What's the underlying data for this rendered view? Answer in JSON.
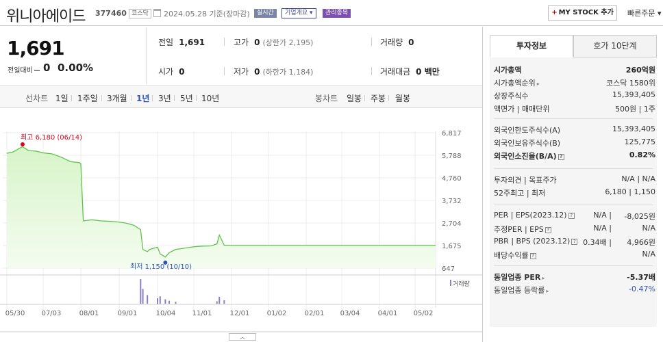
{
  "header": {
    "name": "위니아에이드",
    "code": "377460",
    "market": "코스닥",
    "date": "2024.05.28 기준(장마감)",
    "badge_realtime": "실시간",
    "badge_corp": "기업개요 ▾",
    "badge_admin": "관리종목",
    "mystock": "MY STOCK 추가",
    "quick_order": "빠른주문 ▾",
    "colors": {
      "admin": "#7c4fb0",
      "realtime": "#7b86a6"
    }
  },
  "quote": {
    "price": "1,691",
    "change_label": "전일대비",
    "change": "0",
    "change_pct": "0.00%",
    "stats": [
      {
        "k": "전일",
        "v": "1,691",
        "sub": ""
      },
      {
        "k": "고가",
        "v": "0",
        "sub": "(상한가 2,195)"
      },
      {
        "k": "거래량",
        "v": "0",
        "sub": ""
      },
      {
        "k": "시가",
        "v": "0",
        "sub": ""
      },
      {
        "k": "저가",
        "v": "0",
        "sub": "(하한가 1,184)"
      },
      {
        "k": "거래대금",
        "v": "0 백만",
        "sub": ""
      }
    ]
  },
  "period": {
    "line_label": "선차트",
    "options": [
      "1일",
      "1주일",
      "3개월",
      "1년",
      "3년",
      "5년",
      "10년"
    ],
    "selected": "1년",
    "candle_label": "봉차트",
    "candle_options": [
      "일봉",
      "주봉",
      "월봉"
    ]
  },
  "chart_data": {
    "type": "area",
    "y_ticks": [
      "6,817",
      "5,788",
      "4,760",
      "3,732",
      "2,704",
      "1,675",
      "647"
    ],
    "ylim": [
      647,
      6817
    ],
    "x_ticks": [
      "05/30",
      "07/03",
      "08/01",
      "09/01",
      "10/04",
      "11/01",
      "12/01",
      "01/02",
      "02/01",
      "03/04",
      "04/01",
      "05/02"
    ],
    "high_label": "최고 6,180 (06/14)",
    "low_label": "최저 1,150 (10/10)",
    "volume_label": "거래량",
    "x": [
      "05/30",
      "06/05",
      "06/14",
      "06/20",
      "06/27",
      "07/03",
      "07/10",
      "07/17",
      "07/24",
      "07/31",
      "08/01",
      "08/03",
      "08/10",
      "08/17",
      "08/24",
      "08/31",
      "09/07",
      "09/14",
      "09/20",
      "09/22",
      "09/26",
      "09/28",
      "10/04",
      "10/06",
      "10/10",
      "10/13",
      "10/18",
      "10/24",
      "11/01",
      "11/08",
      "11/15",
      "11/20",
      "11/22",
      "11/26",
      "12/01",
      "01/02",
      "02/01",
      "03/04",
      "04/01",
      "05/02",
      "05/28"
    ],
    "series": [
      {
        "values": [
          5880,
          5940,
          6180,
          6000,
          5980,
          5900,
          5850,
          5700,
          5500,
          5450,
          5400,
          2800,
          2850,
          2800,
          2780,
          2750,
          2700,
          2600,
          2400,
          1500,
          1400,
          1500,
          1600,
          1300,
          1150,
          1350,
          1500,
          1550,
          1620,
          1650,
          1660,
          1750,
          2150,
          1690,
          1691,
          1691,
          1691,
          1691,
          1691,
          1691,
          1691
        ]
      }
    ],
    "volume": [
      {
        "x": "09/20",
        "v": 100
      },
      {
        "x": "09/22",
        "v": 60
      },
      {
        "x": "09/26",
        "v": 35
      },
      {
        "x": "10/04",
        "v": 22
      },
      {
        "x": "10/06",
        "v": 30
      },
      {
        "x": "10/10",
        "v": 18
      },
      {
        "x": "10/13",
        "v": 12
      },
      {
        "x": "10/18",
        "v": 8
      },
      {
        "x": "11/20",
        "v": 10
      },
      {
        "x": "11/22",
        "v": 28
      },
      {
        "x": "11/26",
        "v": 14
      }
    ],
    "colors": {
      "line": "#5cc448",
      "fill_top": "#d7f4c9",
      "fill_bottom": "#f4fcf0",
      "high": "#e0001b",
      "low": "#2f54b8",
      "volume": "#8a7fc0"
    }
  },
  "panel": {
    "tab_invest": "투자정보",
    "tab_ask": "호가 10단계",
    "rows": [
      {
        "k": "시가총액",
        "v": "260억원",
        "bold": true
      },
      {
        "k": "시가총액순위",
        "v": "코스닥 1580위"
      },
      {
        "k": "상장주식수",
        "v": "15,393,405"
      },
      {
        "k": "액면가 | 매매단위",
        "v": "500원 | 1주"
      },
      {
        "k": "외국인한도주식수(A)",
        "v": "15,393,405"
      },
      {
        "k": "외국인보유주식수(B)",
        "v": "125,775"
      },
      {
        "k": "외국인소진율(B/A)",
        "v": "0.82%",
        "bold": true
      },
      {
        "k": "투자의견 | 목표주가",
        "v": "N/A | N/A"
      },
      {
        "k": "52주최고 | 최저",
        "v": "6,180 | 1,150"
      },
      {
        "k": "PER | EPS(2023.12)",
        "v1": "N/A",
        "v": "-8,025원"
      },
      {
        "k": "추정PER | EPS",
        "v1": "N/A",
        "v": "N/A"
      },
      {
        "k": "PBR | BPS (2023.12)",
        "v1": "0.34배",
        "v": "4,966원"
      },
      {
        "k": "배당수익률",
        "v": "N/A"
      },
      {
        "k": "동일업종 PER",
        "v": "-5.37배",
        "bold": true
      },
      {
        "k": "동일업종 등락률",
        "v": "-0.47%",
        "blue": true
      }
    ]
  }
}
